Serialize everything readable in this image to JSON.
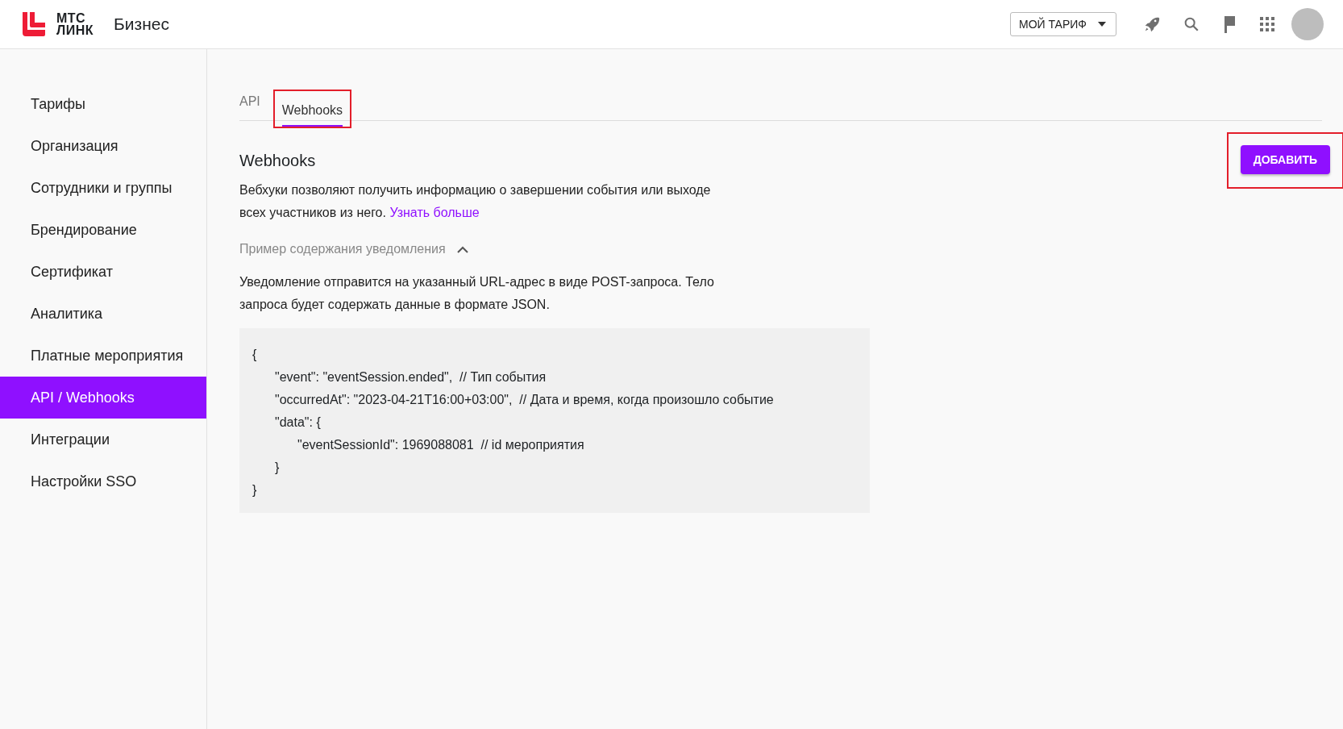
{
  "header": {
    "logo_line_1": "МТС",
    "logo_line_2": "ЛИНК",
    "product": "Бизнес",
    "plan_button": "МОЙ ТАРИФ"
  },
  "sidebar": {
    "items": [
      {
        "label": "Тарифы",
        "selected": false
      },
      {
        "label": "Организация",
        "selected": false
      },
      {
        "label": "Сотрудники и группы",
        "selected": false
      },
      {
        "label": "Брендирование",
        "selected": false
      },
      {
        "label": "Сертификат",
        "selected": false
      },
      {
        "label": "Аналитика",
        "selected": false
      },
      {
        "label": "Платные мероприятия",
        "selected": false
      },
      {
        "label": "API / Webhooks",
        "selected": true
      },
      {
        "label": "Интеграции",
        "selected": false
      },
      {
        "label": "Настройки SSO",
        "selected": false
      }
    ]
  },
  "tabs": [
    {
      "label": "API",
      "selected": false,
      "highlighted": false
    },
    {
      "label": "Webhooks",
      "selected": true,
      "highlighted": true
    }
  ],
  "section": {
    "title": "Webhooks",
    "add_button": {
      "label": "ДОБАВИТЬ",
      "highlighted": true
    },
    "description": "Вебхуки позволяют получить информацию о завершении события или выходе всех участников из него.",
    "learn_more_link": "Узнать больше",
    "example_toggle": {
      "label": "Пример содержания уведомления",
      "expanded": true
    },
    "example_text": "Уведомление отправится на указанный URL-адрес в виде POST-запроса. Тело запроса будет содержать данные в формате JSON.",
    "code": [
      {
        "text": "{",
        "children": [
          {
            "text": "\"event\": \"eventSession.ended\",  // Тип события"
          },
          {
            "text": "\"occurredAt\": \"2023-04-21T16:00+03:00\",  // Дата и время, когда произошло событие"
          },
          {
            "text": "\"data\": {",
            "children": [
              {
                "text": "\"eventSessionId\": 1969088081  // id мероприятия"
              }
            ]
          },
          {
            "text": "}"
          }
        ]
      },
      {
        "text": "}"
      }
    ]
  }
}
